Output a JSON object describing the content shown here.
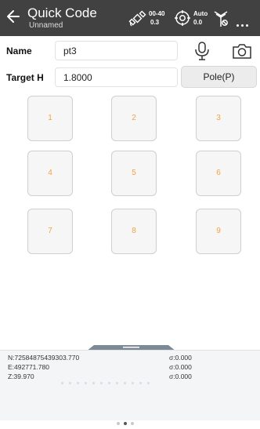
{
  "header": {
    "title": "Quick Code",
    "subtitle": "Unnamed",
    "satellite": {
      "top": "00-40",
      "bottom": "0.3",
      "icon": "satellite-icon"
    },
    "base": {
      "top": "Auto",
      "bottom": "0.0",
      "icon": "target-icon"
    },
    "signal_icon": "antenna-icon",
    "more_icon": "more-icon"
  },
  "form": {
    "name_label": "Name",
    "name_value": "pt3",
    "target_label": "Target H",
    "target_value": "1.8000",
    "pole_button": "Pole(P)",
    "mic_icon": "microphone-icon",
    "camera_icon": "camera-icon"
  },
  "keys": [
    "1",
    "2",
    "3",
    "4",
    "5",
    "6",
    "7",
    "8",
    "9"
  ],
  "status": {
    "n": "N:72584875439303.770",
    "e": "E:492771.780",
    "z": "Z:39.970",
    "sigma_n": "σ:0.000",
    "sigma_e": "σ:0.000",
    "sigma_z": "σ:0.000"
  },
  "colors": {
    "header_bg": "#414141",
    "key_text": "#f2a340",
    "key_bg": "#f6f6f6",
    "status_bg": "#f3f5f7"
  }
}
